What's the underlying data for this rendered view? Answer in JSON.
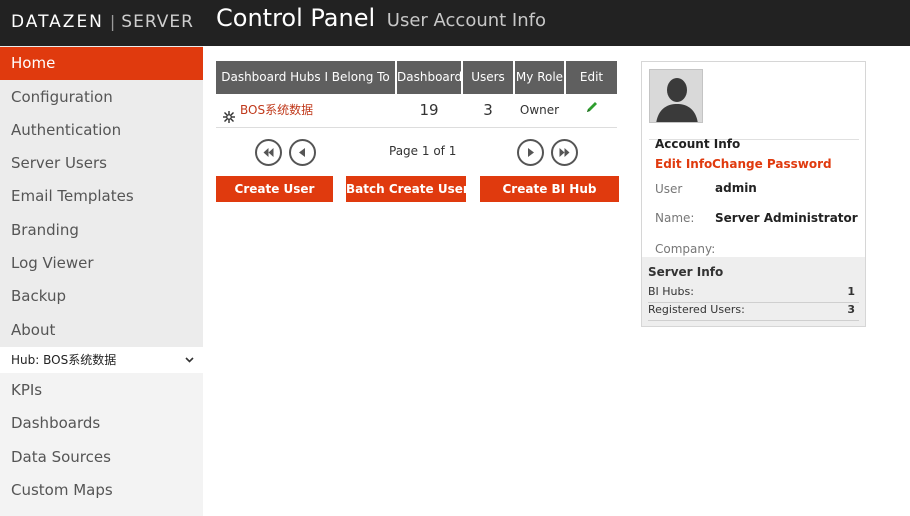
{
  "header": {
    "brand_name": "DATAZEN",
    "brand_separator": "|",
    "brand_product": "SERVER",
    "title": "Control Panel",
    "subtitle": "User Account Info"
  },
  "colors": {
    "accent": "#e03a0e",
    "topbar": "#222222",
    "sidebar": "#ececec",
    "table_header": "#5f5f5f",
    "edit_icon": "#2e9e2e"
  },
  "sidebar": {
    "items": [
      {
        "label": "Home",
        "active": true
      },
      {
        "label": "Configuration"
      },
      {
        "label": "Authentication"
      },
      {
        "label": "Server Users"
      },
      {
        "label": "Email Templates"
      },
      {
        "label": "Branding"
      },
      {
        "label": "Log Viewer"
      },
      {
        "label": "Backup"
      },
      {
        "label": "About"
      }
    ],
    "hub_header": "Hub: BOS系统数据",
    "hub_items": [
      {
        "label": "KPIs"
      },
      {
        "label": "Dashboards"
      },
      {
        "label": "Data Sources"
      },
      {
        "label": "Custom Maps"
      }
    ]
  },
  "hub_table": {
    "columns": [
      "Dashboard Hubs I Belong To",
      "Dashboards",
      "Users",
      "My Role",
      "Edit"
    ],
    "rows": [
      {
        "hub": "BOS系统数据",
        "dashboards": "19",
        "users": "3",
        "role": "Owner",
        "hub_icon": "hub-icon",
        "edit_icon": "pencil-icon"
      }
    ],
    "pagination": {
      "text": "Page 1 of 1"
    }
  },
  "actions": {
    "create_user": "Create User",
    "batch_create_users": "Batch Create Users",
    "create_bi_hub": "Create BI Hub"
  },
  "account": {
    "title": "Account Info",
    "edit_info": "Edit Info",
    "change_password": "Change Password",
    "user_label": "User",
    "user_value": "admin",
    "name_label": "Name:",
    "name_value": "Server Administrator",
    "company_label": "Company:",
    "company_value": ""
  },
  "server_info": {
    "title": "Server Info",
    "rows": [
      {
        "label": "BI Hubs:",
        "value": "1"
      },
      {
        "label": "Registered Users:",
        "value": "3"
      }
    ]
  }
}
